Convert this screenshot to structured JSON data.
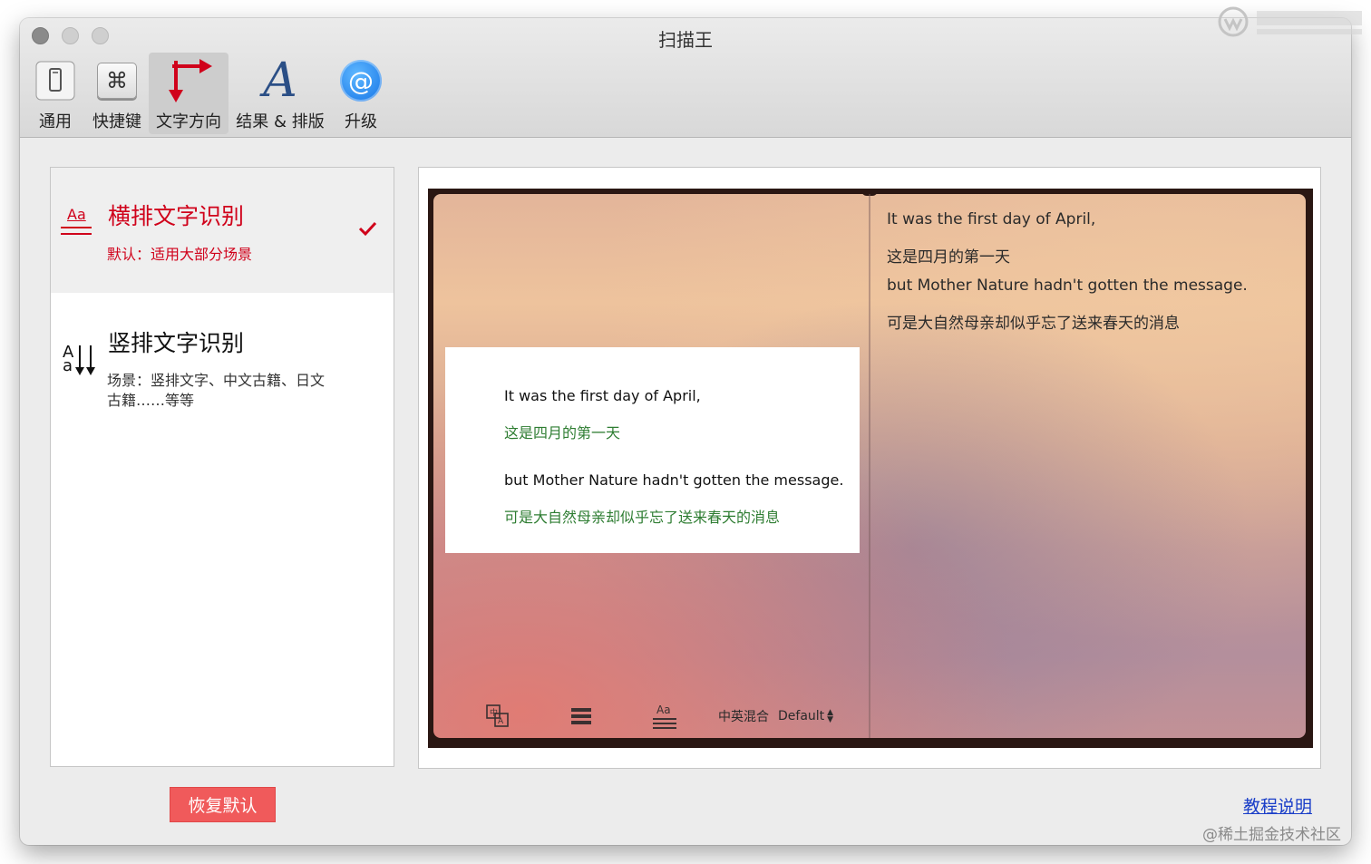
{
  "window": {
    "title": "扫描王"
  },
  "toolbar": {
    "items": [
      {
        "label": "通用",
        "icon": "phone-switch-icon"
      },
      {
        "label": "快捷键",
        "icon": "command-key-icon",
        "glyph": "⌘"
      },
      {
        "label": "文字方向",
        "icon": "text-direction-arrows-icon",
        "active": true
      },
      {
        "label": "结果 & 排版",
        "icon": "serif-a-icon",
        "glyph": "A"
      },
      {
        "label": "升级",
        "icon": "at-sign-icon",
        "glyph": "@"
      }
    ]
  },
  "modes": [
    {
      "title": "横排文字识别",
      "subtitle": "默认：适用大部分场景",
      "icon": "horizontal-text-icon",
      "icon_text": "Aa",
      "selected": true
    },
    {
      "title": "竖排文字识别",
      "subtitle_line1": "场景：竖排文字、中文古籍、日文",
      "subtitle_line2": "古籍……等等",
      "icon": "vertical-text-icon",
      "icon_text_top": "A",
      "icon_text_bottom": "a",
      "selected": false
    }
  ],
  "preview": {
    "card_lines": [
      "It was the first day of April,",
      "这是四月的第一天",
      "but Mother Nature hadn't gotten the message.",
      "可是大自然母亲却似乎忘了送来春天的消息"
    ],
    "result_lines": [
      "It was the first day of April,",
      "这是四月的第一天",
      "but Mother Nature hadn't gotten the message.",
      "可是大自然母亲却似乎忘了送来春天的消息"
    ],
    "bottom_bar": {
      "translate_icon": "translate-icon",
      "list_icon": "list-icon",
      "text_style_icon": "text-style-icon",
      "text_style_icon_text": "Aa",
      "language": "中英混合",
      "font": "Default",
      "stepper_glyph": "⌃⌄"
    }
  },
  "footer": {
    "restore_label": "恢复默认",
    "tutorial_label": "教程说明",
    "watermark": "@稀土掘金技术社区"
  },
  "colors": {
    "accent_red": "#d0021b",
    "restore_button": "#f05a5b",
    "link_blue": "#1a3ec8",
    "ocr_green": "#2e7d32"
  }
}
